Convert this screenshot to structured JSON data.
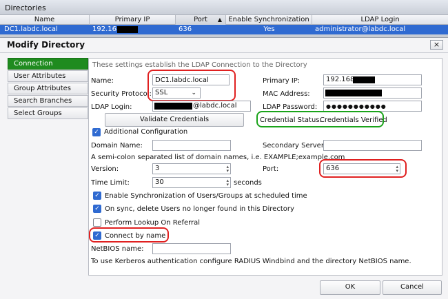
{
  "directories": {
    "title": "Directories",
    "columns": [
      "Name",
      "Primary IP",
      "Port",
      "Enable Synchronization",
      "LDAP Login"
    ],
    "sort_icon": "sort-up-icon",
    "row": {
      "name": "DC1.labdc.local",
      "primary_ip": "192.168.",
      "port": "636",
      "sync": "Yes",
      "login": "administrator@labdc.local"
    }
  },
  "dialog": {
    "title": "Modify Directory",
    "close_glyph": "×",
    "ok_label": "OK",
    "cancel_label": "Cancel"
  },
  "tabs": [
    "Connection",
    "User Attributes",
    "Group Attributes",
    "Search Branches",
    "Select Groups"
  ],
  "connection": {
    "intro": "These settings establish the LDAP Connection to the Directory",
    "name_label": "Name:",
    "name_value": "DC1.labdc.local",
    "protocol_label": "Security Protocol:",
    "protocol_value": "SSL",
    "ldap_login_label": "LDAP Login:",
    "ldap_login_suffix": "@labdc.local",
    "validate_label": "Validate Credentials",
    "primary_ip_label": "Primary IP:",
    "primary_ip_value": "192.168.",
    "mac_label": "MAC Address:",
    "ldap_password_label": "LDAP Password:",
    "ldap_password_value": "●●●●●●●●●●●",
    "credential_status_label": "Credential Status:",
    "credential_status_value": "Credentials Verified",
    "additional_config_label": "Additional Configuration",
    "domain_name_label": "Domain Name:",
    "domain_name_value": "",
    "secondary_server_label": "Secondary Server:",
    "secondary_server_value": "",
    "domain_hint": "A semi-colon separated list of domain names, i.e. EXAMPLE;example.com",
    "version_label": "Version:",
    "version_value": "3",
    "port_label": "Port:",
    "port_value": "636",
    "time_limit_label": "Time Limit:",
    "time_limit_value": "30",
    "seconds_label": "seconds",
    "sync_schedule_label": "Enable Synchronization of Users/Groups at scheduled time",
    "delete_users_label": "On sync, delete Users no longer found in this Directory",
    "referral_label": "Perform Lookup On Referral",
    "connect_by_name_label": "Connect by name",
    "netbios_label": "NetBIOS name:",
    "netbios_value": "",
    "kerberos_hint": "To use Kerberos authentication configure RADIUS Windbind and the directory NetBIOS name."
  },
  "colors": {
    "selection": "#2f6ad1",
    "active_tab": "#1f8b1f",
    "highlight_red": "#e02020",
    "highlight_green": "#1aa31a"
  }
}
